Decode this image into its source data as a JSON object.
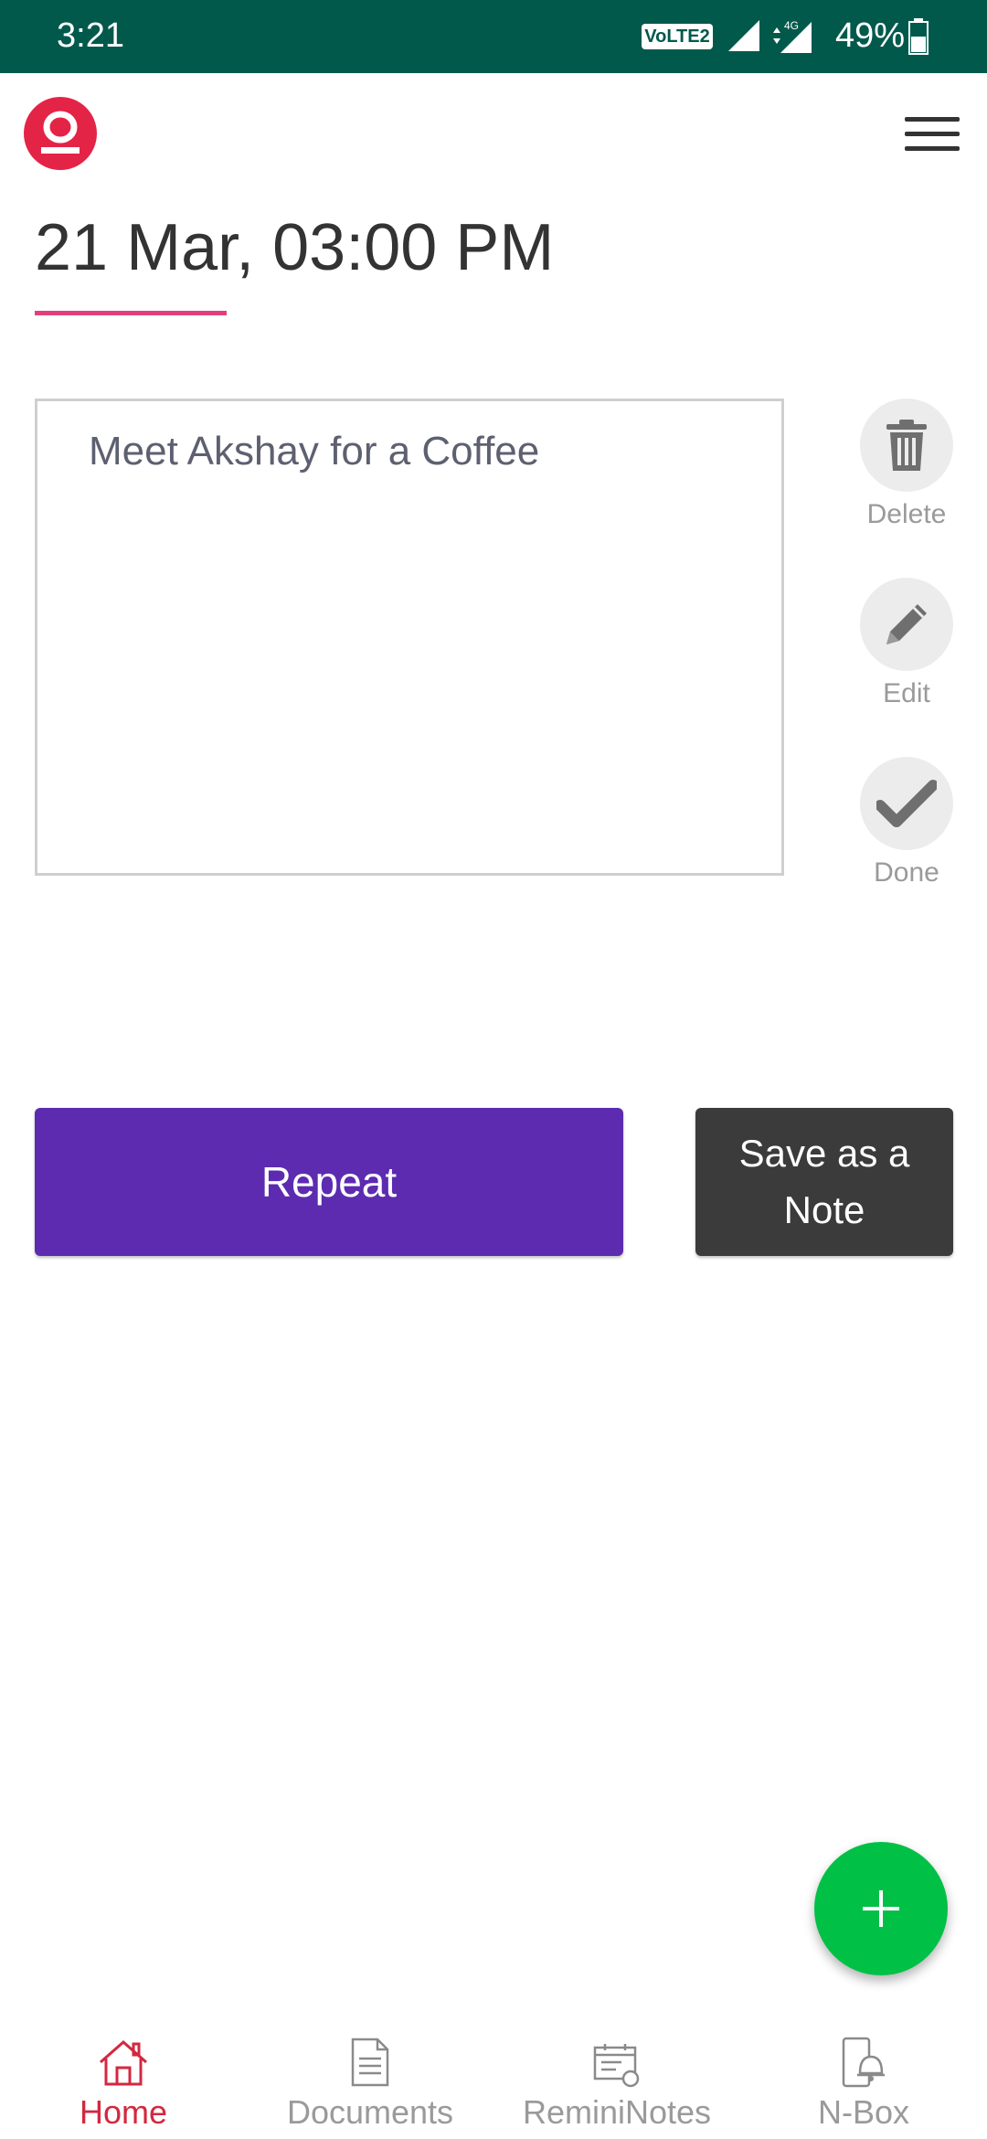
{
  "status_bar": {
    "time": "3:21",
    "volte": "VoLTE 2",
    "network": "4G",
    "battery": "49%"
  },
  "header": {
    "logo_icon": "app-logo-icon",
    "menu_icon": "hamburger-menu-icon"
  },
  "reminder": {
    "datetime": "21 Mar, 03:00 PM",
    "note_text": "Meet Akshay for a Coffee"
  },
  "actions": [
    {
      "label": "Delete",
      "icon": "trash-icon"
    },
    {
      "label": "Edit",
      "icon": "pencil-icon"
    },
    {
      "label": "Done",
      "icon": "checkmark-icon"
    }
  ],
  "buttons": {
    "repeat": "Repeat",
    "save_line1": "Save as a",
    "save_line2": "Note"
  },
  "fab": {
    "icon": "plus-icon"
  },
  "bottom_nav": [
    {
      "label": "Home",
      "icon": "home-icon",
      "active": true
    },
    {
      "label": "Documents",
      "icon": "document-icon",
      "active": false
    },
    {
      "label": "ReminiNotes",
      "icon": "reminder-note-icon",
      "active": false
    },
    {
      "label": "N-Box",
      "icon": "phone-bell-icon",
      "active": false
    }
  ],
  "colors": {
    "status_bar": "#01594c",
    "accent_underline": "#e0407d",
    "repeat_button": "#5c2bb0",
    "save_button": "#3b3b3b",
    "fab": "#00c046",
    "active_nav": "#d3283f"
  }
}
